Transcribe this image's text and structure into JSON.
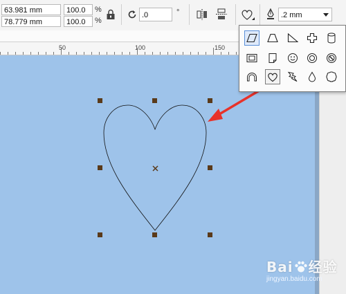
{
  "toolbar": {
    "width_value": "63.981 mm",
    "height_value": "78.779 mm",
    "scale_x": "100.0",
    "scale_y": "100.0",
    "percent_symbol": "%",
    "rotation_value": ".0",
    "degree_symbol": "°",
    "outline_width": ".2 mm",
    "icons": [
      "lock-ratio-icon",
      "rotate-icon",
      "mirror-horizontal-icon",
      "mirror-vertical-icon",
      "basic-shapes-icon",
      "outline-pen-icon"
    ]
  },
  "ruler": {
    "labels": [
      "50",
      "100",
      "150"
    ]
  },
  "shape_picker": {
    "selected_shape": "heart-shape-icon",
    "shapes": [
      "parallelogram-shape-icon",
      "trapezoid-shape-icon",
      "right-triangle-shape-icon",
      "cross-shape-icon",
      "cylinder-shape-icon",
      "frame-shape-icon",
      "folded-corner-shape-icon",
      "smiley-shape-icon",
      "donut-shape-icon",
      "no-symbol-shape-icon",
      "arch-shape-icon",
      "heart-shape-icon",
      "lightning-shape-icon",
      "teardrop-shape-icon",
      "scalloped-shape-icon"
    ]
  },
  "canvas": {
    "background_color": "#9ec3ea",
    "shape": "heart",
    "arrow_color": "#e8322a",
    "handle_color": "#5a3a1a"
  },
  "watermark": {
    "brand": "Bai",
    "brand_cn": "经验",
    "url": "jingyan.baidu.com"
  }
}
